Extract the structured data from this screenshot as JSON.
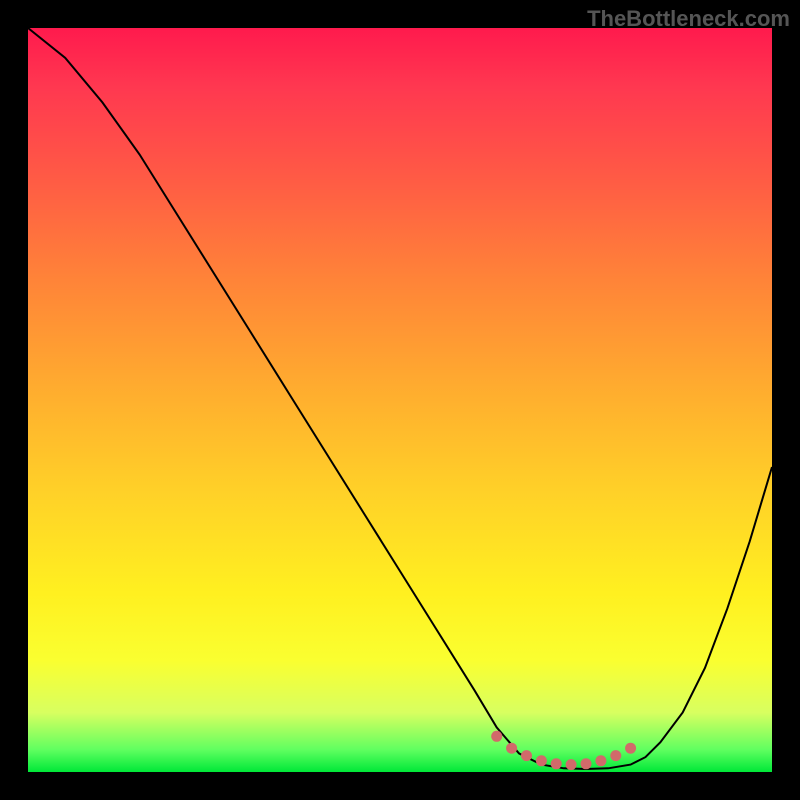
{
  "watermark": "TheBottleneck.com",
  "chart_data": {
    "type": "line",
    "title": "",
    "xlabel": "",
    "ylabel": "",
    "xlim": [
      0,
      100
    ],
    "ylim": [
      0,
      100
    ],
    "series": [
      {
        "name": "curve",
        "x": [
          0,
          5,
          10,
          15,
          20,
          25,
          30,
          35,
          40,
          45,
          50,
          55,
          60,
          63,
          66,
          69,
          72,
          75,
          78,
          81,
          83,
          85,
          88,
          91,
          94,
          97,
          100
        ],
        "values": [
          100,
          96,
          90,
          83,
          75,
          67,
          59,
          51,
          43,
          35,
          27,
          19,
          11,
          6,
          2.5,
          1.0,
          0.5,
          0.4,
          0.5,
          1.0,
          2.0,
          4.0,
          8.0,
          14,
          22,
          31,
          41
        ]
      },
      {
        "name": "highlight-dots",
        "x": [
          63,
          65,
          67,
          69,
          71,
          73,
          75,
          77,
          79,
          81
        ],
        "values": [
          4.8,
          3.2,
          2.2,
          1.5,
          1.1,
          1.0,
          1.1,
          1.5,
          2.2,
          3.2
        ]
      }
    ],
    "colors": {
      "curve": "#000000",
      "dots": "#d16a6a"
    },
    "background_gradient_stops": [
      {
        "pos": 0.0,
        "color": "#ff1a4d"
      },
      {
        "pos": 0.08,
        "color": "#ff3850"
      },
      {
        "pos": 0.2,
        "color": "#ff5a45"
      },
      {
        "pos": 0.34,
        "color": "#ff8438"
      },
      {
        "pos": 0.48,
        "color": "#ffab2f"
      },
      {
        "pos": 0.62,
        "color": "#ffd028"
      },
      {
        "pos": 0.76,
        "color": "#fff020"
      },
      {
        "pos": 0.85,
        "color": "#faff30"
      },
      {
        "pos": 0.92,
        "color": "#d8ff60"
      },
      {
        "pos": 0.97,
        "color": "#60ff60"
      },
      {
        "pos": 1.0,
        "color": "#00e838"
      }
    ]
  }
}
